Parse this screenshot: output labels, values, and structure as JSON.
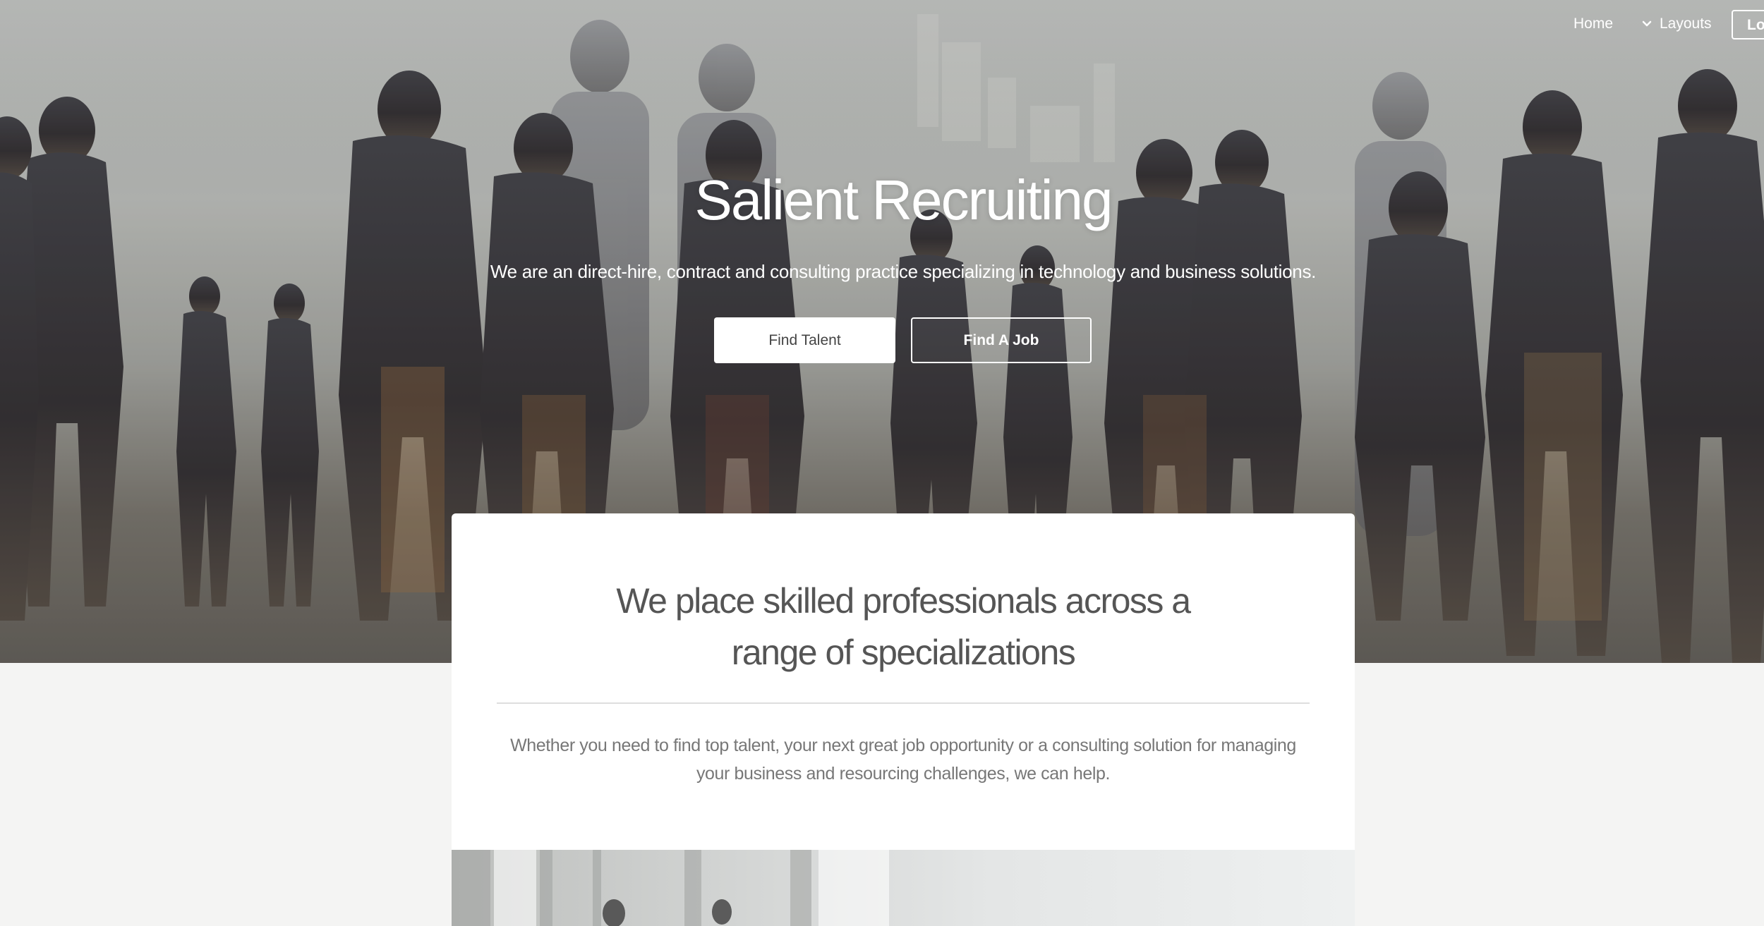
{
  "nav": {
    "home_label": "Home",
    "layouts_label": "Layouts",
    "login_label": "Log"
  },
  "hero": {
    "title": "Salient Recruiting",
    "subtitle": "We are an direct-hire, contract and consulting practice specializing in technology and business solutions.",
    "find_talent_label": "Find Talent",
    "find_job_label": "Find A Job"
  },
  "card": {
    "title_line1": "We place skilled professionals across a",
    "title_line2": "range of specializations",
    "body": "Whether you need to find top talent, your next great job opportunity or a consulting solution for managing your business and resourcing challenges, we can help."
  },
  "colors": {
    "page_background": "#f4f4f3",
    "card_background": "#ffffff",
    "hero_text": "#ffffff",
    "card_heading": "#555555",
    "card_body": "#777777"
  },
  "icons": {
    "layouts_dropdown": "chevron-down-icon"
  }
}
